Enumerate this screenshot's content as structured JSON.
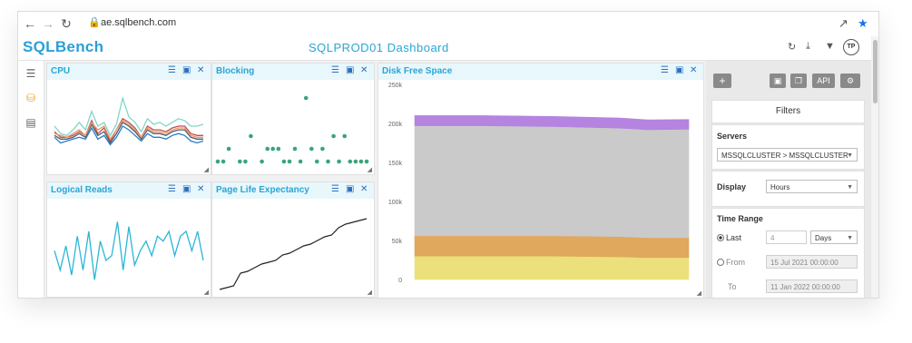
{
  "browser": {
    "url": "ae.sqlbench.com"
  },
  "app": {
    "logo_sql": "SQL",
    "logo_bench": "Bench",
    "title": "SQLPROD01 Dashboard",
    "avatar": "TP"
  },
  "panels": {
    "cpu": {
      "title": "CPU"
    },
    "blocking": {
      "title": "Blocking"
    },
    "disk": {
      "title": "Disk Free Space",
      "y_ticks": [
        "250k",
        "200k",
        "150k",
        "100k",
        "50k",
        "0"
      ]
    },
    "reads": {
      "title": "Logical Reads"
    },
    "ple": {
      "title": "Page Life Expectancy"
    }
  },
  "toolbar": {
    "api_label": "API"
  },
  "filters": {
    "title": "Filters",
    "servers_label": "Servers",
    "servers_value": "MSSQLCLUSTER > MSSQLCLUSTER",
    "display_label": "Display",
    "display_value": "Hours",
    "time_range_label": "Time Range",
    "last_label": "Last",
    "last_value": "4",
    "last_unit": "Days",
    "from_label": "From",
    "from_value": "15 Jul 2021 00:00:00",
    "to_label": "To",
    "to_value": "11 Jan 2022 00:00:00",
    "selected_range": "last"
  },
  "colors": {
    "accent": "#2ba6d6",
    "panel_header": "#e8f7fb",
    "icon_blue": "#2f6fbf"
  },
  "chart_data": [
    {
      "type": "line",
      "panel": "CPU",
      "x": [
        1,
        2,
        3,
        4,
        5,
        6,
        7,
        8,
        9,
        10,
        11,
        12,
        13,
        14,
        15,
        16,
        17,
        18,
        19,
        20,
        21,
        22,
        23,
        24,
        25
      ],
      "series": [
        {
          "color": "#7fd6c8",
          "values": [
            40,
            32,
            30,
            36,
            44,
            36,
            56,
            40,
            44,
            30,
            42,
            70,
            50,
            44,
            34,
            48,
            42,
            44,
            40,
            44,
            48,
            46,
            40,
            40,
            42
          ]
        },
        {
          "color": "#c0504d",
          "values": [
            34,
            28,
            28,
            30,
            34,
            30,
            46,
            32,
            38,
            24,
            36,
            48,
            44,
            38,
            28,
            40,
            36,
            36,
            34,
            38,
            40,
            40,
            32,
            30,
            30
          ]
        },
        {
          "color": "#4f5966",
          "values": [
            30,
            26,
            26,
            28,
            32,
            28,
            42,
            30,
            34,
            22,
            32,
            44,
            40,
            34,
            26,
            36,
            32,
            32,
            30,
            34,
            36,
            36,
            28,
            26,
            26
          ]
        },
        {
          "color": "#2b7cc4",
          "values": [
            28,
            22,
            24,
            26,
            28,
            26,
            38,
            26,
            30,
            20,
            28,
            40,
            36,
            30,
            24,
            32,
            28,
            28,
            26,
            30,
            32,
            30,
            24,
            22,
            24
          ]
        },
        {
          "color": "#e89a6b",
          "values": [
            32,
            30,
            28,
            32,
            36,
            30,
            44,
            36,
            40,
            26,
            36,
            46,
            42,
            36,
            28,
            38,
            34,
            34,
            32,
            36,
            38,
            38,
            30,
            28,
            28
          ]
        }
      ]
    },
    {
      "type": "scatter",
      "panel": "Blocking",
      "series": [
        {
          "color": "#3aa57a",
          "x": [
            1,
            2,
            3,
            5,
            6,
            7,
            9,
            10,
            11,
            12,
            13,
            14,
            15,
            16,
            17,
            18,
            19,
            20,
            21,
            22,
            23,
            24,
            25,
            26,
            27,
            28
          ],
          "y": [
            0,
            0,
            1,
            0,
            0,
            2,
            0,
            1,
            1,
            1,
            0,
            0,
            1,
            0,
            5,
            1,
            0,
            1,
            0,
            2,
            0,
            2,
            0,
            0,
            0,
            0
          ]
        }
      ]
    },
    {
      "type": "area",
      "panel": "Disk Free Space",
      "ylim": [
        0,
        250000
      ],
      "x": [
        0,
        0.25,
        0.5,
        0.75,
        0.85,
        1
      ],
      "series": [
        {
          "color": "#ece07c",
          "values": [
            30000,
            30000,
            30000,
            29000,
            28000,
            28000
          ]
        },
        {
          "color": "#e0a85c",
          "values": [
            26000,
            26000,
            26000,
            26000,
            25500,
            25500
          ]
        },
        {
          "color": "#cacaca",
          "values": [
            141000,
            141000,
            140000,
            139000,
            138500,
            139000
          ]
        },
        {
          "color": "#b583e0",
          "values": [
            13000,
            13000,
            13000,
            13000,
            12500,
            12500
          ]
        }
      ]
    },
    {
      "type": "line",
      "panel": "Logical Reads",
      "series": [
        {
          "color": "#2ab6d6",
          "values": [
            40,
            20,
            45,
            15,
            55,
            20,
            60,
            10,
            50,
            30,
            35,
            70,
            20,
            65,
            25,
            40,
            50,
            35,
            55,
            50,
            60,
            35,
            55,
            60,
            40,
            60,
            30
          ]
        }
      ]
    },
    {
      "type": "line",
      "panel": "Page Life Expectancy",
      "series": [
        {
          "color": "#222222",
          "values": [
            2,
            4,
            6,
            20,
            22,
            26,
            30,
            32,
            34,
            40,
            42,
            46,
            50,
            52,
            56,
            60,
            62,
            70,
            74,
            76,
            78,
            80
          ]
        }
      ]
    }
  ]
}
